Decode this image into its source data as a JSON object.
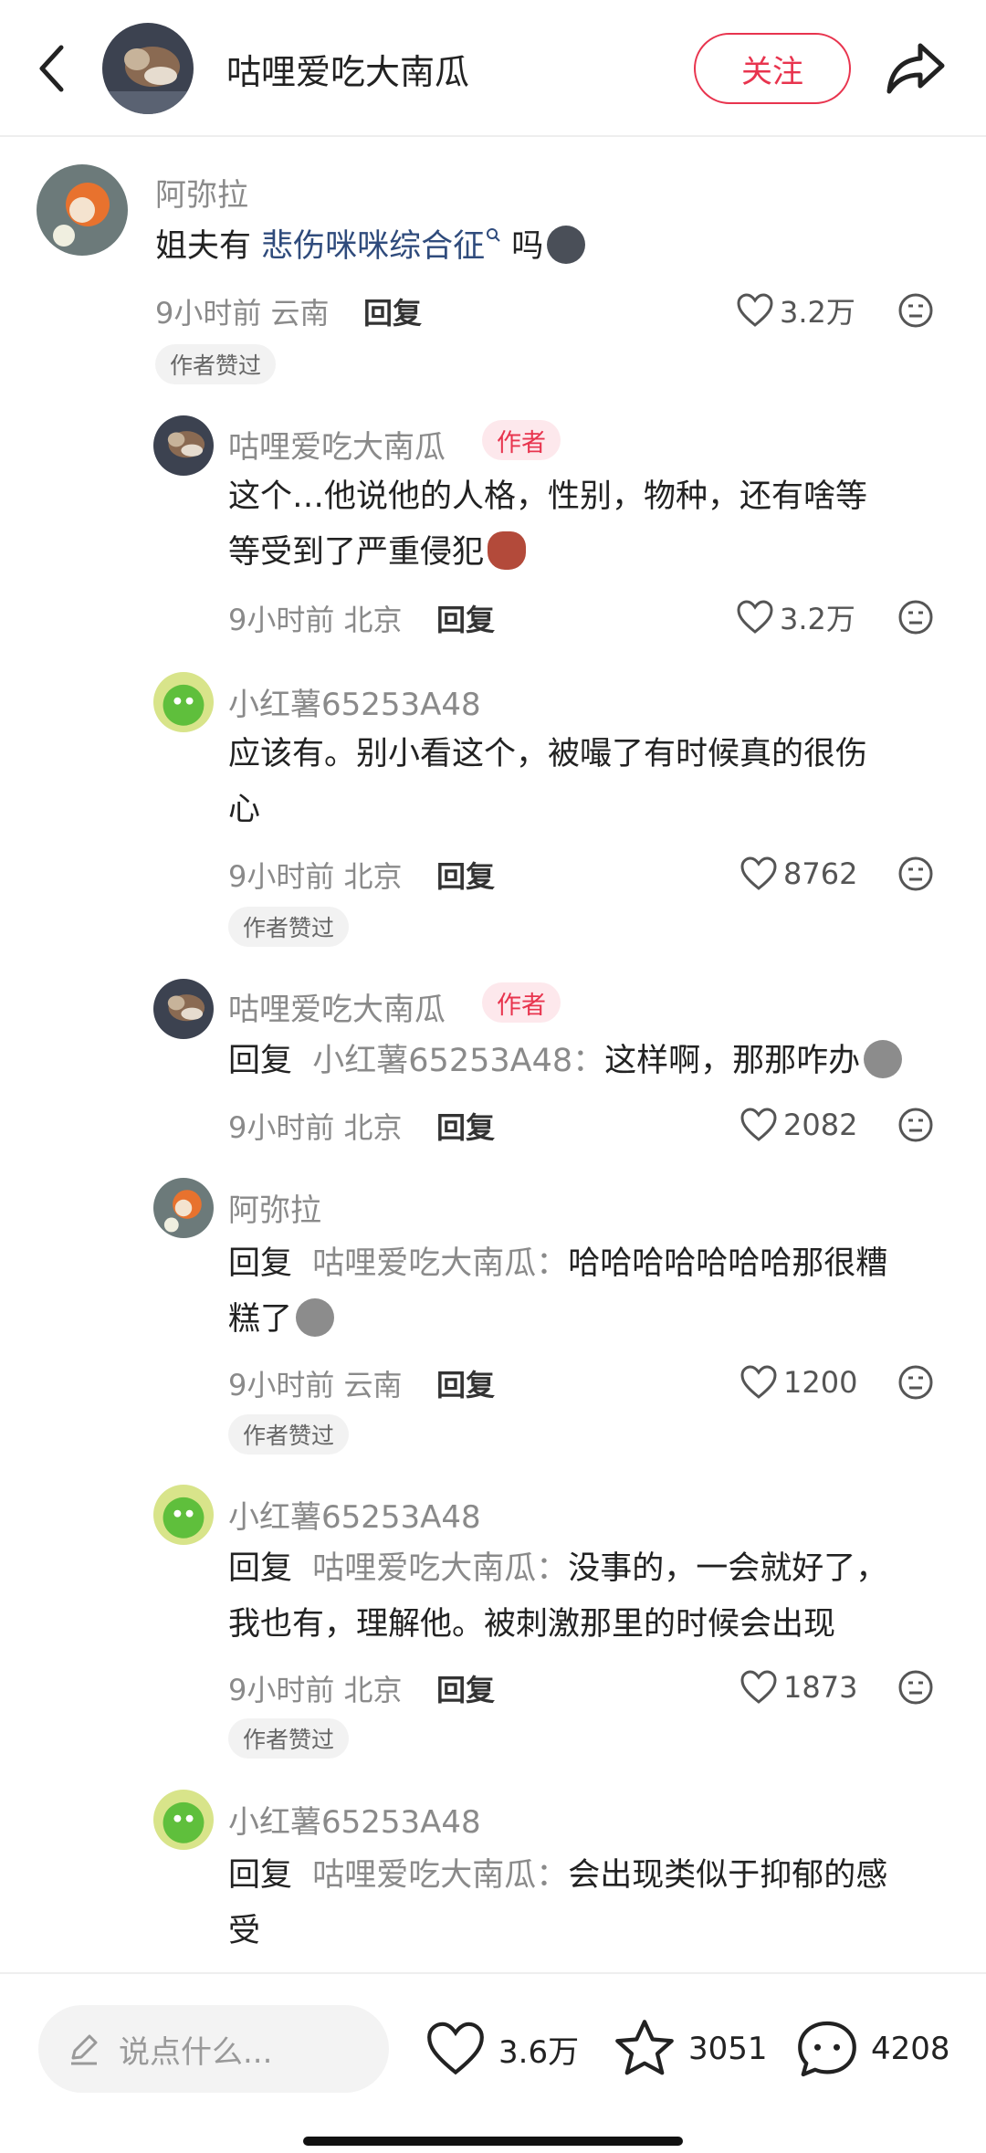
{
  "header": {
    "title": "咕哩爱吃大南瓜",
    "follow_label": "关注"
  },
  "comments": [
    {
      "user": "阿弥拉",
      "text_prefix": "姐夫有 ",
      "text_link": "悲伤咪咪综合征",
      "text_suffix": " 吗",
      "time": "9小时前 云南",
      "reply_label": "回复",
      "likes": "3.2万",
      "liked_badge": "作者赞过"
    },
    {
      "user": "咕哩爱吃大南瓜",
      "author_tag": "作者",
      "text_line1": "这个…他说他的人格，性别，物种，还有啥等",
      "text_line2": "等受到了严重侵犯",
      "time": "9小时前 北京",
      "reply_label": "回复",
      "likes": "3.2万"
    },
    {
      "user": "小红薯65253A48",
      "text_line1": "应该有。别小看这个，被嘬了有时候真的很伤",
      "text_line2": "心",
      "time": "9小时前 北京",
      "reply_label": "回复",
      "likes": "8762",
      "liked_badge": "作者赞过"
    },
    {
      "user": "咕哩爱吃大南瓜",
      "author_tag": "作者",
      "reply_prefix": "回复",
      "reply_to": "小红薯65253A48：",
      "text": "这样啊，那那咋办",
      "time": "9小时前 北京",
      "reply_label": "回复",
      "likes": "2082"
    },
    {
      "user": "阿弥拉",
      "reply_prefix": "回复",
      "reply_to": "咕哩爱吃大南瓜：",
      "text_line1": "哈哈哈哈哈哈哈那很糟",
      "text_line2": "糕了",
      "time": "9小时前 云南",
      "reply_label": "回复",
      "likes": "1200",
      "liked_badge": "作者赞过"
    },
    {
      "user": "小红薯65253A48",
      "reply_prefix": "回复",
      "reply_to": "咕哩爱吃大南瓜：",
      "text_line1": "没事的，一会就好了，",
      "text_line2": "我也有，理解他。被刺激那里的时候会出现",
      "time": "9小时前 北京",
      "reply_label": "回复",
      "likes": "1873",
      "liked_badge": "作者赞过"
    },
    {
      "user": "小红薯65253A48",
      "reply_prefix": "回复",
      "reply_to": "咕哩爱吃大南瓜：",
      "text_line1": "会出现类似于抑郁的感",
      "text_line2": "受"
    }
  ],
  "bottom": {
    "input_placeholder": "说点什么...",
    "likes": "3.6万",
    "stars": "3051",
    "comments": "4208"
  },
  "colors": {
    "accent": "#e8344e",
    "link": "#2f4b7c",
    "muted": "#8a8a8a"
  },
  "icons": [
    "back-arrow-icon",
    "share-icon",
    "heart-icon",
    "dislike-face-icon",
    "pencil-icon",
    "star-icon",
    "comment-bubble-icon"
  ]
}
